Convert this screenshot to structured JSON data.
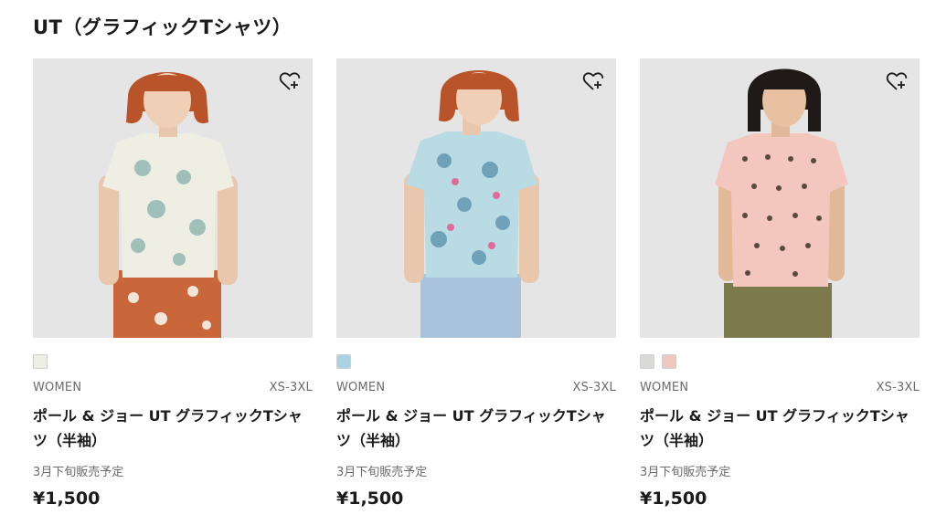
{
  "page": {
    "title": "UT（グラフィックTシャツ）"
  },
  "products": [
    {
      "category": "WOMEN",
      "sizes": "XS-3XL",
      "name": "ポール & ジョー UT グラフィックTシャツ（半袖）",
      "availability": "3月下旬販売予定",
      "price": "¥1,500",
      "swatches": [
        "#efeee4"
      ],
      "hair_color": "#b9532a",
      "shirt_color": "#efeee3",
      "shirt_print": "#9fbfb8",
      "bottom_color": "#c9663a"
    },
    {
      "category": "WOMEN",
      "sizes": "XS-3XL",
      "name": "ポール & ジョー UT グラフィックTシャツ（半袖）",
      "availability": "3月下旬販売予定",
      "price": "¥1,500",
      "swatches": [
        "#a9d3df"
      ],
      "hair_color": "#b9532a",
      "shirt_color": "#b9dbe4",
      "shirt_print": "#6fa2b8",
      "bottom_color": "#a9c3dc"
    },
    {
      "category": "WOMEN",
      "sizes": "XS-3XL",
      "name": "ポール & ジョー UT グラフィックTシャツ（半袖）",
      "availability": "3月下旬販売予定",
      "price": "¥1,500",
      "swatches": [
        "#d9dad6",
        "#f0c8c0"
      ],
      "hair_color": "#1f1a17",
      "shirt_color": "#f3c7bd",
      "shirt_print": "#5a4a3e",
      "bottom_color": "#7c7a4c"
    }
  ]
}
